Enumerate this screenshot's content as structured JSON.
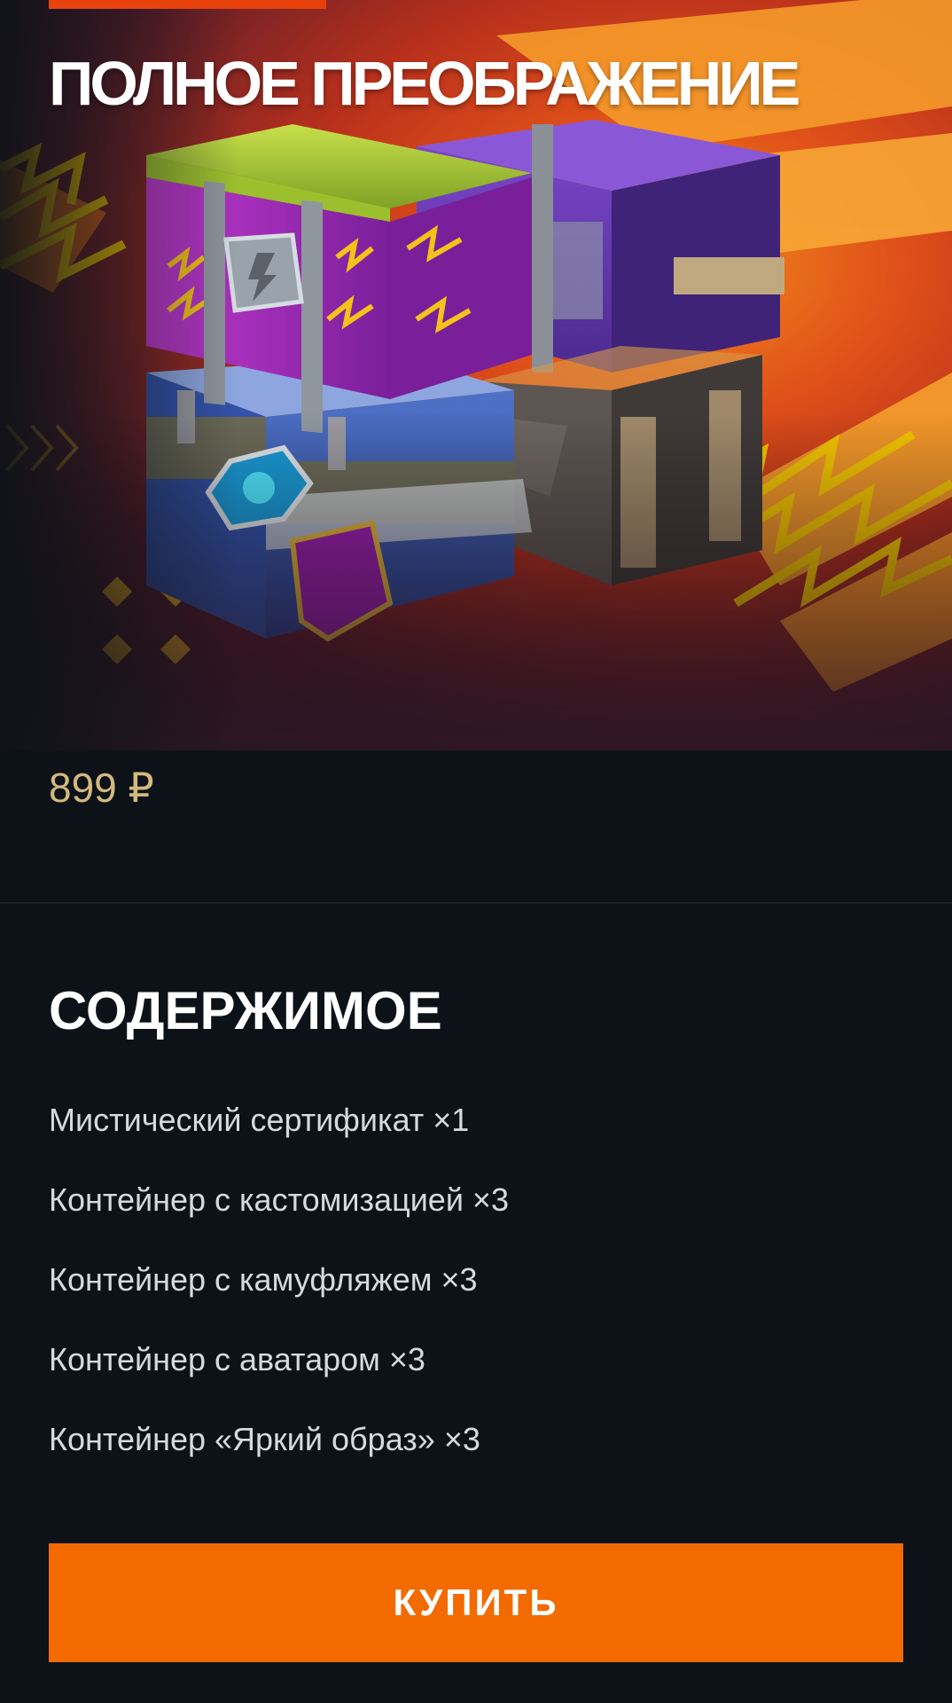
{
  "offer": {
    "title": "ПОЛНОЕ ПРЕОБРАЖЕНИЕ",
    "image": "container-bundle-illustration",
    "price": "899 ₽"
  },
  "contents": {
    "heading": "СОДЕРЖИМОЕ",
    "items": [
      "Мистический сертификат ×1",
      "Контейнер с кастомизацией ×3",
      "Контейнер с камуфляжем ×3",
      "Контейнер с аватаром ×3",
      "Контейнер «Яркий образ» ×3"
    ]
  },
  "actions": {
    "buy_label": "КУПИТЬ"
  },
  "colors": {
    "background": "#0c1218",
    "accent": "#f26a00",
    "price": "#d4b97f",
    "top_accent": "#e8420c"
  }
}
